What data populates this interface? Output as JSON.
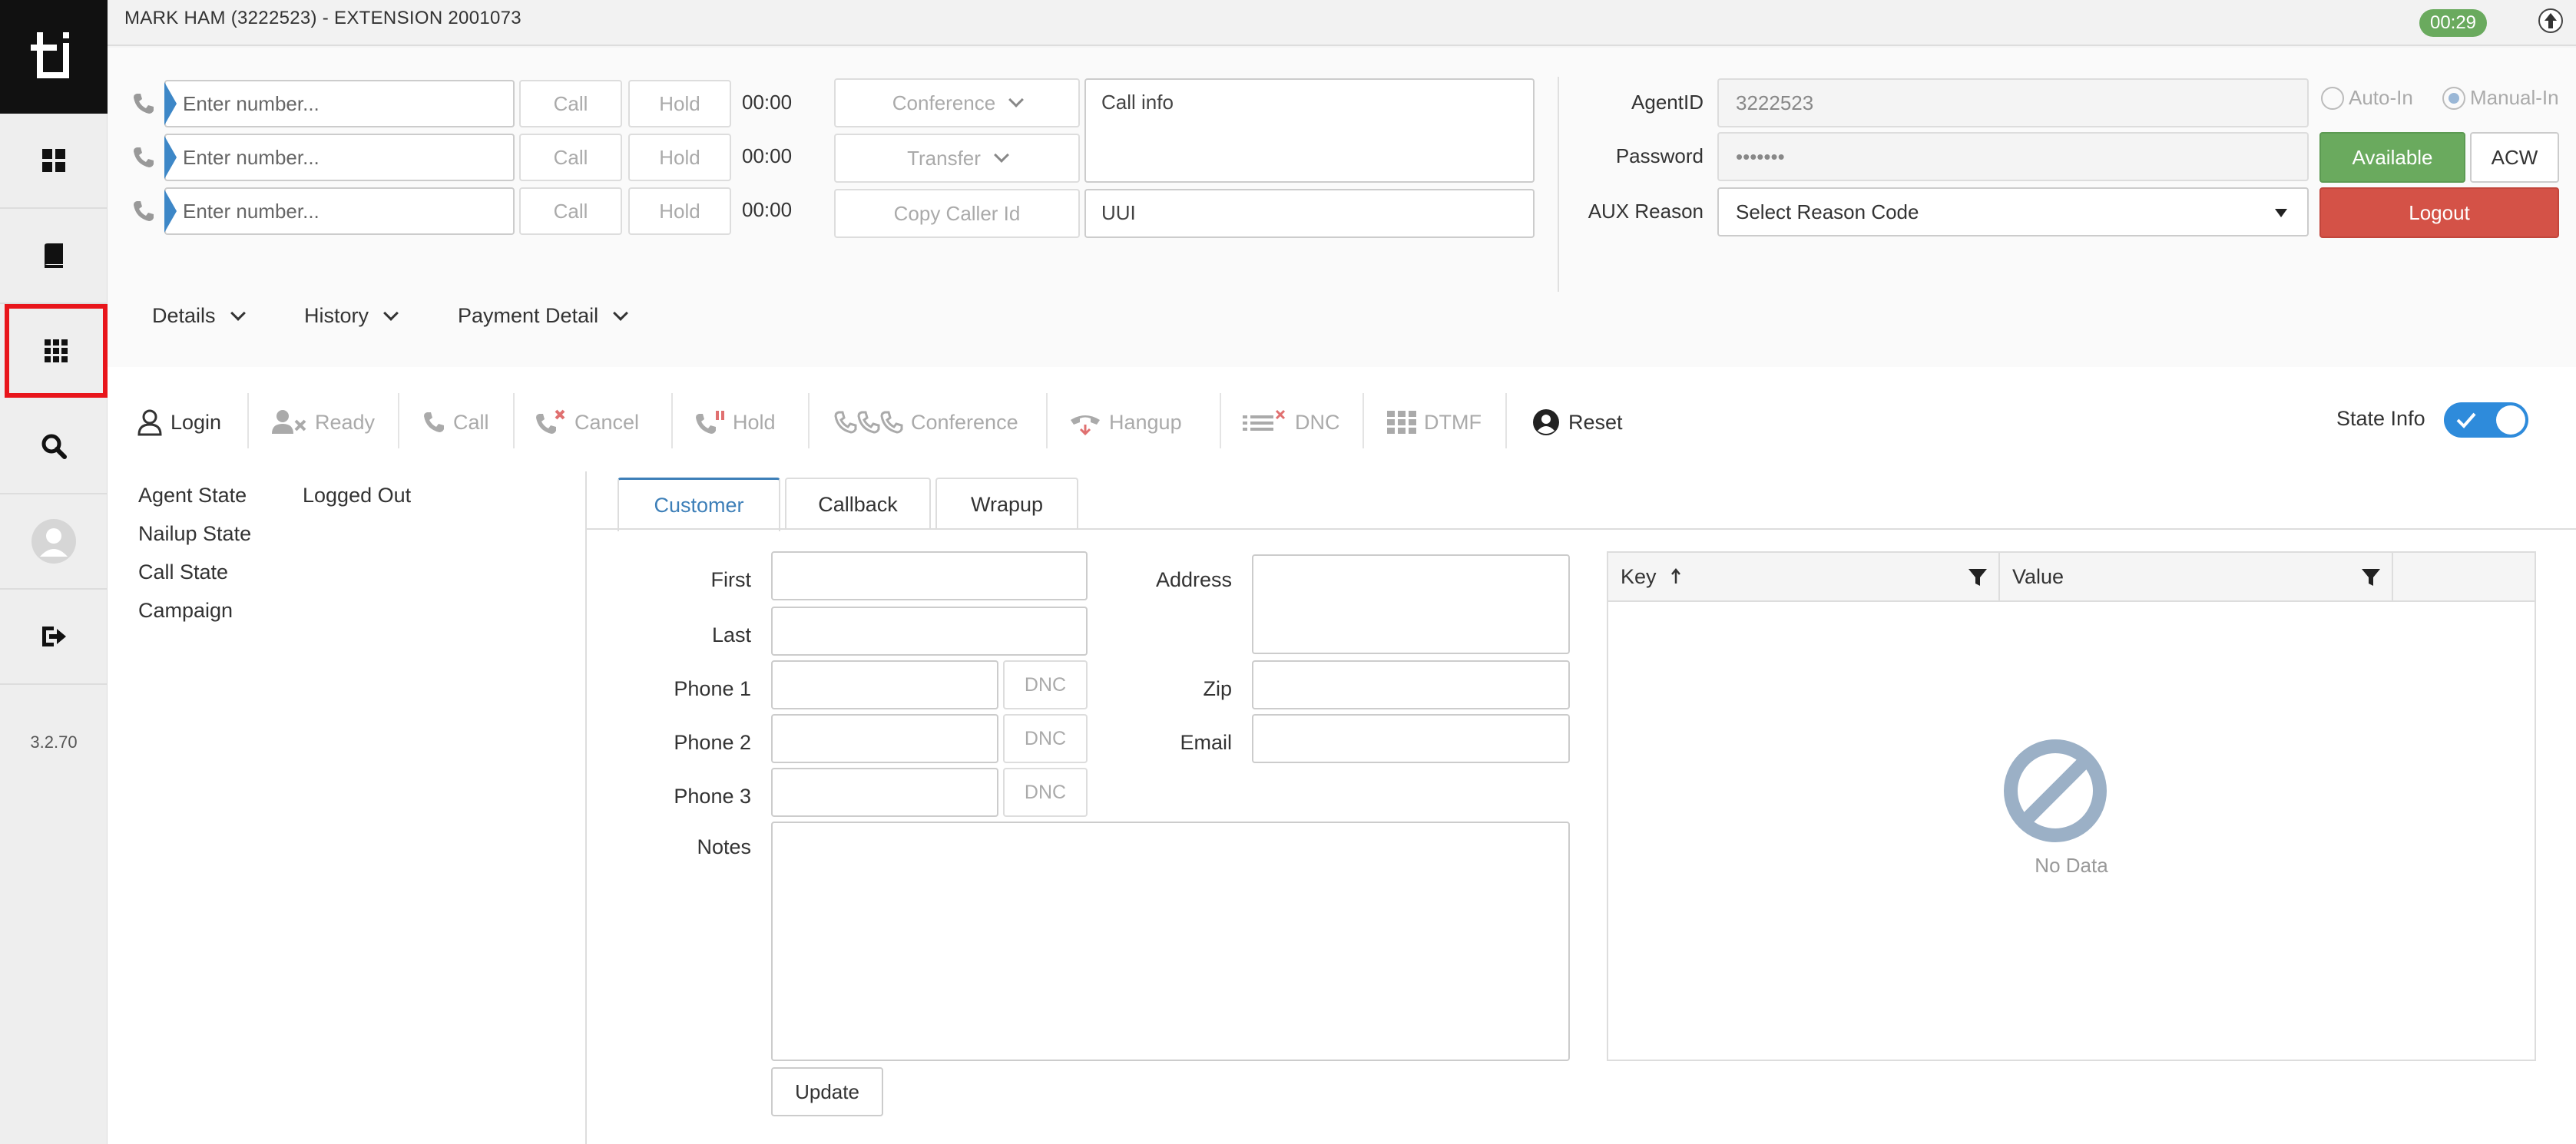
{
  "app": {
    "title": "MARK HAM (3222523) - EXTENSION 2001073",
    "timer_badge": "00:29",
    "version": "3.2.70"
  },
  "sidebar": {
    "items": [
      {
        "icon": "dashboard-icon"
      },
      {
        "icon": "book-icon"
      },
      {
        "icon": "apps-grid-icon",
        "highlighted": true
      },
      {
        "icon": "search-icon"
      },
      {
        "icon": "user-avatar-icon"
      },
      {
        "icon": "sign-out-icon"
      }
    ],
    "highlight_color": "#e8151b"
  },
  "lines": [
    {
      "placeholder": "Enter number...",
      "call": "Call",
      "hold": "Hold",
      "timer": "00:00"
    },
    {
      "placeholder": "Enter number...",
      "call": "Call",
      "hold": "Hold",
      "timer": "00:00"
    },
    {
      "placeholder": "Enter number...",
      "call": "Call",
      "hold": "Hold",
      "timer": "00:00"
    }
  ],
  "call_actions": {
    "conference": "Conference",
    "transfer": "Transfer",
    "copy_caller_id": "Copy Caller Id",
    "call_info": "Call info",
    "uui": "UUI"
  },
  "agent": {
    "agentid_label": "AgentID",
    "agentid_value": "3222523",
    "password_label": "Password",
    "password_value": "•••••••",
    "aux_label": "AUX Reason",
    "aux_value": "Select Reason Code",
    "auto_in": "Auto-In",
    "manual_in": "Manual-In",
    "available": "Available",
    "acw": "ACW",
    "logout": "Logout"
  },
  "subnav": [
    "Details",
    "History",
    "Payment Detail"
  ],
  "toolbar": {
    "login": "Login",
    "ready": "Ready",
    "call": "Call",
    "cancel": "Cancel",
    "hold": "Hold",
    "conference": "Conference",
    "hangup": "Hangup",
    "dnc": "DNC",
    "dtmf": "DTMF",
    "reset": "Reset",
    "state_info": "State Info"
  },
  "state": {
    "rows": [
      {
        "label": "Agent State",
        "value": "Logged Out"
      },
      {
        "label": "Nailup State",
        "value": ""
      },
      {
        "label": "Call State",
        "value": ""
      },
      {
        "label": "Campaign",
        "value": ""
      }
    ]
  },
  "tabs": [
    "Customer",
    "Callback",
    "Wrapup"
  ],
  "customer": {
    "first": "First",
    "last": "Last",
    "phone1": "Phone 1",
    "phone2": "Phone 2",
    "phone3": "Phone 3",
    "dnc": "DNC",
    "notes": "Notes",
    "address": "Address",
    "zip": "Zip",
    "email": "Email",
    "update": "Update"
  },
  "grid": {
    "key": "Key",
    "value": "Value",
    "empty": "No Data"
  },
  "colors": {
    "accent": "#2e8bdb",
    "available": "#6aaa5e",
    "logout": "#d45247"
  }
}
